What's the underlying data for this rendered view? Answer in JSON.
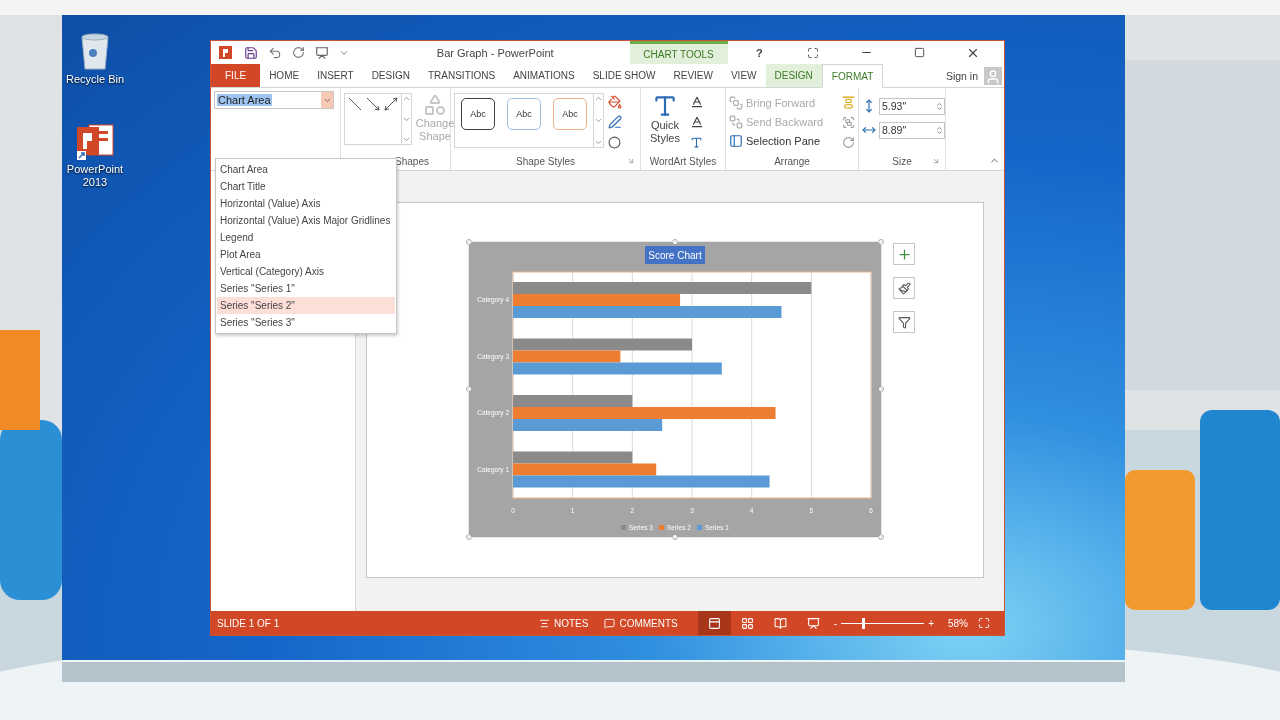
{
  "desktop_icons": [
    {
      "label": "Recycle Bin",
      "kind": "recycle-bin"
    },
    {
      "label": "PowerPoint 2013",
      "kind": "powerpoint"
    }
  ],
  "window": {
    "title": "Bar Graph - PowerPoint",
    "context_title": "CHART TOOLS",
    "help": "?",
    "sign_in": "Sign in"
  },
  "tabs": [
    {
      "label": "FILE",
      "kind": "file",
      "selected": false
    },
    {
      "label": "HOME",
      "kind": "tab",
      "selected": false
    },
    {
      "label": "INSERT",
      "kind": "tab",
      "selected": false
    },
    {
      "label": "DESIGN",
      "kind": "tab",
      "selected": false
    },
    {
      "label": "TRANSITIONS",
      "kind": "tab",
      "selected": false
    },
    {
      "label": "ANIMATIONS",
      "kind": "tab",
      "selected": false
    },
    {
      "label": "SLIDE SHOW",
      "kind": "tab",
      "selected": false
    },
    {
      "label": "REVIEW",
      "kind": "tab",
      "selected": false
    },
    {
      "label": "VIEW",
      "kind": "tab",
      "selected": false
    },
    {
      "label": "DESIGN",
      "kind": "context",
      "selected": false
    },
    {
      "label": "FORMAT",
      "kind": "context",
      "selected": true
    }
  ],
  "ribbon": {
    "selection_box": {
      "value": "Chart Area",
      "expanded": true
    },
    "selection_menu": [
      {
        "label": "Chart Area",
        "selected": false
      },
      {
        "label": "Chart Title",
        "selected": false
      },
      {
        "label": "Horizontal (Value) Axis",
        "selected": false
      },
      {
        "label": "Horizontal (Value) Axis Major Gridlines",
        "selected": false
      },
      {
        "label": "Legend",
        "selected": false
      },
      {
        "label": "Plot Area",
        "selected": false
      },
      {
        "label": "Vertical (Category) Axis",
        "selected": false
      },
      {
        "label": "Series \"Series 1\"",
        "selected": false
      },
      {
        "label": "Series \"Series 2\"",
        "selected": true
      },
      {
        "label": "Series \"Series 3\"",
        "selected": false
      }
    ],
    "insert_shapes": {
      "change_shape": "Change Shape",
      "change_shape_disabled": true,
      "group_label": "Shapes"
    },
    "shape_styles": {
      "samples": [
        {
          "label": "Abc",
          "color": "#404040"
        },
        {
          "label": "Abc",
          "color": "#9dc3e6"
        },
        {
          "label": "Abc",
          "color": "#f4b183"
        }
      ],
      "group_label": "Shape Styles"
    },
    "wordart": {
      "quick_styles": "Quick Styles",
      "group_label": "WordArt Styles"
    },
    "arrange": {
      "items": [
        {
          "label": "Bring Forward",
          "kind": "forward",
          "disabled": true
        },
        {
          "label": "Send Backward",
          "kind": "backward",
          "disabled": true
        },
        {
          "label": "Selection Pane",
          "kind": "pane",
          "disabled": false
        }
      ],
      "group_label": "Arrange"
    },
    "size": {
      "fields": [
        {
          "value": "5.93\"",
          "kind": "height"
        },
        {
          "value": "8.89\"",
          "kind": "width"
        }
      ],
      "group_label": "Size"
    }
  },
  "chart": {
    "chart_data": {
      "type": "bar",
      "orientation": "horizontal",
      "title": "Score Chart",
      "categories": [
        "Category 4",
        "Category 3",
        "Category 2",
        "Category 1"
      ],
      "series": [
        {
          "name": "Series 1",
          "color": "#5b9bd5",
          "values": [
            4.5,
            3.5,
            2.5,
            4.3
          ]
        },
        {
          "name": "Series 2",
          "color": "#ed7d31",
          "values": [
            2.8,
            1.8,
            4.4,
            2.4
          ]
        },
        {
          "name": "Series 3",
          "color": "#8a8a8a",
          "values": [
            5,
            3,
            2,
            2
          ]
        }
      ],
      "xlim": [
        0,
        6
      ],
      "xticks": [
        0,
        1,
        2,
        3,
        4,
        5,
        6
      ],
      "grid": true,
      "legend": "bottom"
    }
  },
  "status_bar": {
    "slide": "SLIDE 1 OF 1",
    "notes": "NOTES",
    "comments": "COMMENTS",
    "views": [
      {
        "kind": "normal",
        "selected": true
      },
      {
        "kind": "sorter",
        "selected": false
      },
      {
        "kind": "reading",
        "selected": false
      },
      {
        "kind": "slideshow",
        "selected": false
      }
    ],
    "zoom": {
      "minus": "-",
      "plus": "+",
      "level": 0.25,
      "reading": "58%"
    }
  }
}
